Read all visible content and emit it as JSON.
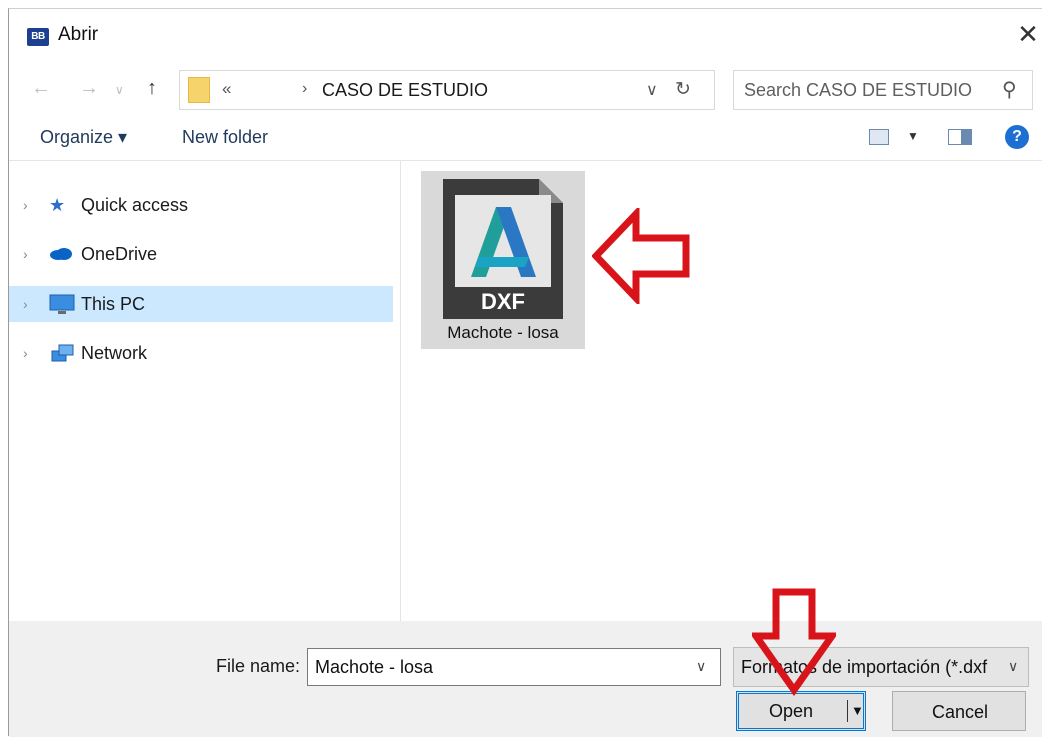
{
  "window": {
    "title": "Abrir",
    "app_icon_text": "BB"
  },
  "address": {
    "overflow_label": "«",
    "separator": "›",
    "current_folder": "CASO DE ESTUDIO",
    "dropdown_glyph": "∨",
    "refresh_glyph": "↻"
  },
  "search": {
    "placeholder": "Search CASO DE ESTUDIO"
  },
  "toolbar": {
    "organize_label": "Organize ▾",
    "new_folder_label": "New folder",
    "help_label": "?"
  },
  "navigation": [
    {
      "label": "Quick access",
      "icon": "star-icon",
      "selected": false
    },
    {
      "label": "OneDrive",
      "icon": "cloud-icon",
      "selected": false
    },
    {
      "label": "This PC",
      "icon": "computer-icon",
      "selected": true
    },
    {
      "label": "Network",
      "icon": "network-icon",
      "selected": false
    }
  ],
  "files": [
    {
      "name": "Machote - losa",
      "type_badge": "DXF",
      "icon": "autocad-dxf-icon",
      "selected": true
    }
  ],
  "bottom": {
    "file_name_label": "File name:",
    "file_name_value": "Machote - losa",
    "file_type_value": "Formatos de importación (*.dxf",
    "open_label": "Open",
    "cancel_label": "Cancel"
  },
  "colors": {
    "selection": "#cce8ff",
    "annotation_arrow": "#d8141a",
    "accent": "#0078d7"
  }
}
